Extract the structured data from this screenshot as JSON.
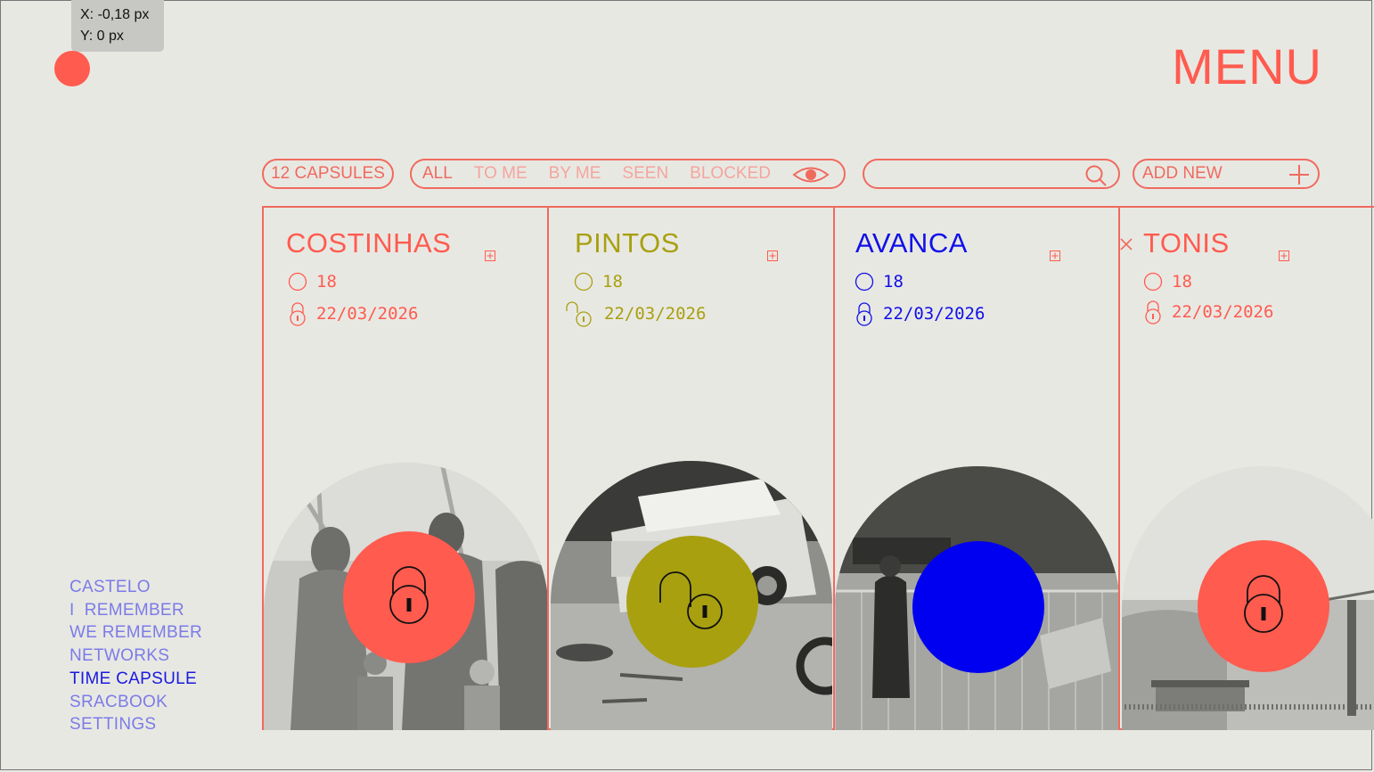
{
  "coords": {
    "x": "X: -0,18 px",
    "y": "Y: 0 px"
  },
  "header": {
    "menu_label": "MENU"
  },
  "toolbar": {
    "capsules_count": "12 CAPSULES",
    "filters": [
      {
        "label": "ALL",
        "active": true
      },
      {
        "label": "TO ME"
      },
      {
        "label": "BY ME"
      },
      {
        "label": "SEEN"
      },
      {
        "label": "BLOCKED"
      }
    ],
    "visibility_icon": "eye-icon",
    "search": {
      "placeholder": "",
      "icon": "search-icon"
    },
    "add_new": "ADD NEW"
  },
  "cards": [
    {
      "title": "COSTINHAS",
      "count": "18",
      "date": "22/03/2026",
      "color": "#ff5b4f",
      "lock": "locked",
      "photo": "family portrait"
    },
    {
      "title": "PINTOS",
      "count": "18",
      "date": "22/03/2026",
      "color": "#a8a00f",
      "lock": "unlocked",
      "photo": "jeep"
    },
    {
      "title": "AVANCA",
      "count": "18",
      "date": "22/03/2026",
      "color": "#1010e8",
      "lock": "locked",
      "photo": "street scene"
    },
    {
      "title": "TONIS",
      "count": "18",
      "date": "22/03/2026",
      "color": "#ff5b4f",
      "lock": "locked",
      "photo": "concert"
    }
  ],
  "sidebar": {
    "items": [
      "CASTELO",
      "I  REMEMBER",
      "WE REMEMBER",
      "NETWORKS",
      "TIME CAPSULE",
      "SRACBOOK",
      "SETTINGS"
    ],
    "active": "TIME CAPSULE"
  },
  "colors": {
    "accent": "#ff5b4f",
    "olive": "#a8a00f",
    "blue": "#1010e8",
    "nav": "#7b7be8",
    "background": "#e8e8e3"
  }
}
